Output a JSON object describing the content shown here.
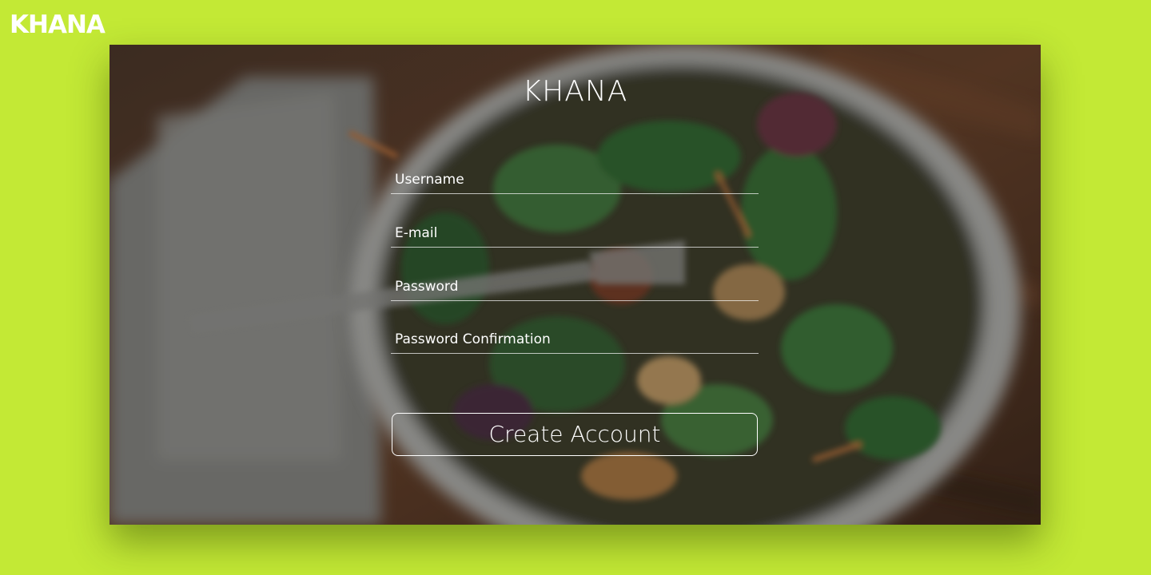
{
  "brand": {
    "logo_text": "KHANA",
    "accent_color": "#c3e935"
  },
  "form": {
    "title": "KHANA",
    "fields": [
      {
        "placeholder": "Username",
        "value": ""
      },
      {
        "placeholder": "E-mail",
        "value": ""
      },
      {
        "placeholder": "Password",
        "value": ""
      },
      {
        "placeholder": "Password Confirmation",
        "value": ""
      }
    ],
    "submit_label": "Create Account"
  }
}
